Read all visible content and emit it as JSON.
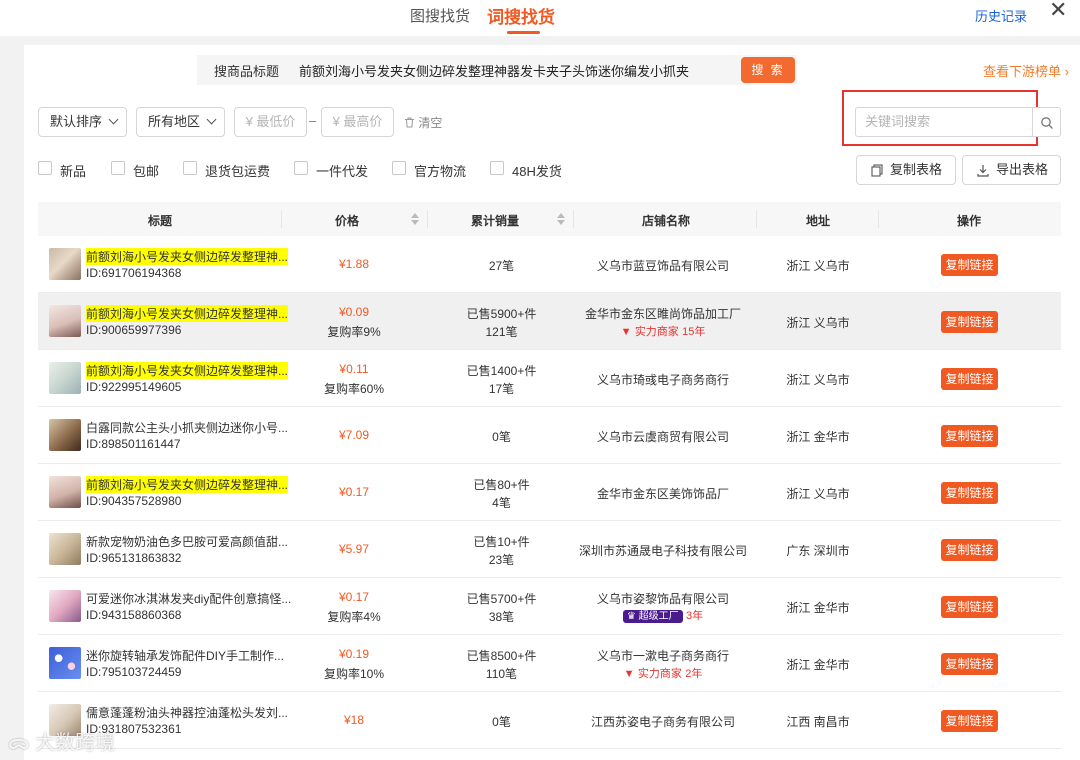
{
  "header": {
    "tab_image_search": "图搜找货",
    "tab_word_search": "词搜找货",
    "history": "历史记录",
    "close": "✕"
  },
  "search": {
    "label": "搜商品标题",
    "value": "前额刘海小号发夹女侧边碎发整理神器发卡夹子头饰迷你编发小抓夹",
    "button": "搜 索",
    "downstream": "查看下游榜单"
  },
  "filters": {
    "sort": "默认排序",
    "region": "所有地区",
    "min_price": "¥ 最低价",
    "max_price": "¥ 最高价",
    "dash": "–",
    "clear": "清空",
    "keyword_placeholder": "关键词搜索"
  },
  "checkboxes": [
    "新品",
    "包邮",
    "退货包运费",
    "一件代发",
    "官方物流",
    "48H发货"
  ],
  "actions": {
    "copy_table": "复制表格",
    "export_table": "导出表格"
  },
  "table": {
    "headers": [
      "标题",
      "价格",
      "累计销量",
      "店铺名称",
      "地址",
      "操作"
    ],
    "copy_label": "复制链接",
    "rows": [
      {
        "title": "前额刘海小号发夹女侧边碎发整理神...",
        "id": "ID:691706194368",
        "price": "¥1.88",
        "repurchase": "",
        "sold": "",
        "orders": "27笔",
        "shop": "义乌市蓝豆饰品有限公司",
        "badge": "",
        "badge_years": "",
        "address": "浙江 义乌市"
      },
      {
        "title": "前额刘海小号发夹女侧边碎发整理神...",
        "id": "ID:900659977396",
        "price": "¥0.09",
        "repurchase": "复购率9%",
        "sold": "已售5900+件",
        "orders": "121笔",
        "shop": "金华市金东区睢尚饰品加工厂",
        "badge": "实力商家",
        "badge_years": "15年",
        "address": "浙江 义乌市"
      },
      {
        "title": "前额刘海小号发夹女侧边碎发整理神...",
        "id": "ID:922995149605",
        "price": "¥0.11",
        "repurchase": "复购率60%",
        "sold": "已售1400+件",
        "orders": "17笔",
        "shop": "义乌市琦彧电子商务商行",
        "badge": "",
        "badge_years": "",
        "address": "浙江 义乌市"
      },
      {
        "title": "白露同款公主头小抓夹侧边迷你小号...",
        "id": "ID:898501161447",
        "price": "¥7.09",
        "repurchase": "",
        "sold": "",
        "orders": "0笔",
        "shop": "义乌市云虞商贸有限公司",
        "badge": "",
        "badge_years": "",
        "address": "浙江 金华市"
      },
      {
        "title": "前额刘海小号发夹女侧边碎发整理神...",
        "id": "ID:904357528980",
        "price": "¥0.17",
        "repurchase": "",
        "sold": "已售80+件",
        "orders": "4笔",
        "shop": "金华市金东区美饰饰品厂",
        "badge": "",
        "badge_years": "",
        "address": "浙江 义乌市"
      },
      {
        "title": "新款宠物奶油色多巴胺可爱高颜值甜...",
        "id": "ID:965131863832",
        "price": "¥5.97",
        "repurchase": "",
        "sold": "已售10+件",
        "orders": "23笔",
        "shop": "深圳市苏通晟电子科技有限公司",
        "badge": "",
        "badge_years": "",
        "address": "广东 深圳市"
      },
      {
        "title": "可爱迷你冰淇淋发夹diy配件创意搞怪...",
        "id": "ID:943158860368",
        "price": "¥0.17",
        "repurchase": "复购率4%",
        "sold": "已售5700+件",
        "orders": "38笔",
        "shop": "义乌市姿黎饰品有限公司",
        "badge": "超级工厂",
        "badge_years": "3年",
        "address": "浙江 金华市"
      },
      {
        "title": "迷你旋转轴承发饰配件DIY手工制作...",
        "id": "ID:795103724459",
        "price": "¥0.19",
        "repurchase": "复购率10%",
        "sold": "已售8500+件",
        "orders": "110笔",
        "shop": "义乌市一漱电子商务商行",
        "badge": "实力商家",
        "badge_years": "2年",
        "address": "浙江 金华市"
      },
      {
        "title": "儒意蓬蓬粉油头神器控油蓬松头发刘...",
        "id": "ID:931807532361",
        "price": "¥18",
        "repurchase": "",
        "sold": "",
        "orders": "0笔",
        "shop": "江西苏姿电子商务有限公司",
        "badge": "",
        "badge_years": "",
        "address": "江西 南昌市"
      }
    ]
  },
  "watermark": "大数跨境",
  "colors": {
    "accent": "#f05a22",
    "link": "#1a62d8",
    "highlight": "#ffff00",
    "annotation": "#e8332e",
    "super_factory": "#4a1b8c"
  }
}
